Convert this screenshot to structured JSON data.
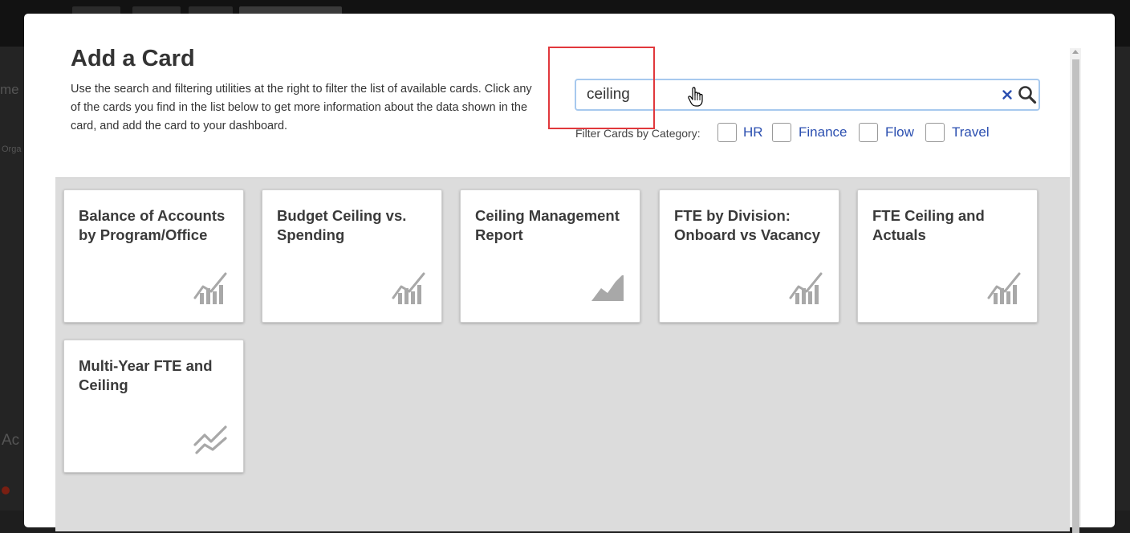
{
  "modal": {
    "title": "Add a Card",
    "description": "Use the search and filtering utilities at the right to filter the list of available cards. Click any of the cards you find in the list below to get more information about the data shown in the card, and add the card to your dashboard."
  },
  "search": {
    "value": "ceiling"
  },
  "filter": {
    "label": "Filter Cards by Category:",
    "categories": [
      {
        "label": "HR"
      },
      {
        "label": "Finance"
      },
      {
        "label": "Flow"
      },
      {
        "label": "Travel"
      }
    ]
  },
  "cards": [
    {
      "title": "Balance of Accounts by Program/Office",
      "icon": "bar-line-chart-icon"
    },
    {
      "title": "Budget Ceiling vs. Spending",
      "icon": "bar-line-chart-icon"
    },
    {
      "title": "Ceiling Management Report",
      "icon": "area-chart-icon"
    },
    {
      "title": "FTE by Division: Onboard vs Vacancy",
      "icon": "bar-line-chart-icon"
    },
    {
      "title": "FTE Ceiling and Actuals",
      "icon": "bar-line-chart-icon"
    },
    {
      "title": "Multi-Year FTE and Ceiling",
      "icon": "multi-line-chart-icon"
    }
  ],
  "background": {
    "partial_texts": [
      "me",
      "Orga",
      "Ac"
    ]
  },
  "colors": {
    "accent_link": "#2b4fb0",
    "highlight": "#e1383c",
    "search_border": "#a7c9ee",
    "icon_gray": "#a8a8a8",
    "card_area_bg": "#dcdcdc"
  }
}
